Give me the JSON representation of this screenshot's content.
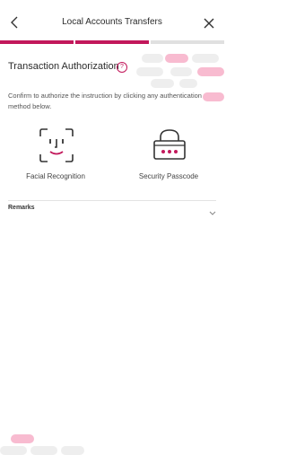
{
  "header": {
    "title": "Local Accounts Transfers",
    "back_icon": "chevron-left-icon",
    "close_icon": "close-icon"
  },
  "progress": {
    "current_step": 2,
    "total_steps": 3
  },
  "colors": {
    "accent": "#c2185b",
    "accent_light": "#f8bbd0",
    "inactive": "#e0e0e0",
    "deco_grey": "#eeeeee"
  },
  "auth": {
    "title": "Transaction Authorization",
    "help_label": "?",
    "description": "Confirm to authorize the instruction by clicking any authentication method below.",
    "methods": [
      {
        "label": "Facial Recognition",
        "icon": "face-recognition-icon"
      },
      {
        "label": "Security Passcode",
        "icon": "passcode-lock-icon"
      }
    ]
  },
  "remarks": {
    "label": "Remarks",
    "icon": "chevron-down-icon"
  }
}
